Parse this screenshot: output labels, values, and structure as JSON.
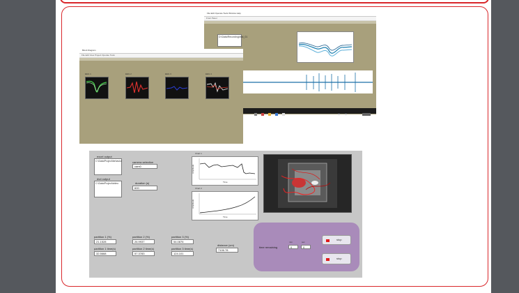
{
  "top_window": {
    "title": "File  Edit  Operate  Tools  Window  Help",
    "menu": "Front Panel",
    "list_text": "D:\\Data\\Recording\\trial_01"
  },
  "left_window": {
    "title": "Block Diagram",
    "menu": "File  Edit  View  Project  Operate  Tools",
    "graph_labels": [
      "EEG 1",
      "EEG 2",
      "EEG 3",
      "EEG 4"
    ]
  },
  "main_panel": {
    "excel_output_label": "excel output",
    "excel_output_value": "C:\\Data\\Project\\behavior",
    "camera_selection_label": "camera selection",
    "camera_selection_value": "cam0",
    "dvd_output_label": "dvd output",
    "dvd_output_value": "C:\\Data\\Project\\video",
    "duration_label": "duration (s)",
    "duration_value": "600",
    "chart1_title": "Chart 1",
    "chart2_title": "Chart 2",
    "chart_xlabel": "Time",
    "chart_ylabel": "Amplitude",
    "partition_labels": [
      "partition 1 (%)",
      "partition 2 (%)",
      "partition 3 (%)"
    ],
    "partition_values": [
      "21.1528",
      "26.9937",
      "54.0876"
    ],
    "partition_time_labels": [
      "partition 1 time(s)",
      "partition 2 time(s)",
      "partition 3 time(s)"
    ],
    "partition_time_values": [
      "32.5668",
      "57.3783",
      "124.101"
    ],
    "distance_label": "distance (cm)",
    "distance_value": "7106.78",
    "time_remaining_label": "time remaining",
    "min_label": "min",
    "sec_label": "sec",
    "min_value": "0",
    "sec_value": "0",
    "stop_label": "stop",
    "stop2_label": "stop"
  },
  "colors": {
    "accent_red": "#d9262a",
    "panel_tan": "#a8a07c",
    "panel_gray": "#c7c7c7",
    "purple_cluster": "#a98bba"
  }
}
